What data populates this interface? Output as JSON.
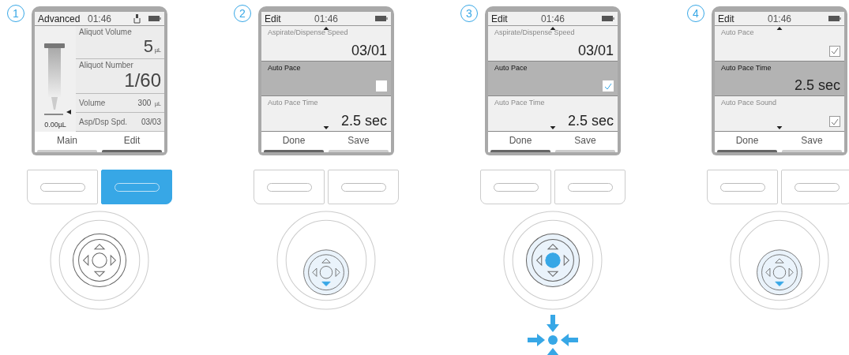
{
  "steps": [
    {
      "number": "1",
      "screen": {
        "title": "Advanced",
        "time": "01:46",
        "usb": true,
        "kind": "main",
        "tip_volume": "0.00µL",
        "fields": [
          {
            "kind": "large",
            "label": "Aliquot Volume",
            "value": "5",
            "unit": "µL"
          },
          {
            "kind": "large",
            "label": "Aliquot Number",
            "value": "1/60"
          },
          {
            "kind": "inline",
            "label": "Volume",
            "value": "300",
            "unit": "µL"
          },
          {
            "kind": "inline",
            "label": "Asp/Dsp Spd.",
            "value": "03/03"
          }
        ]
      },
      "softkeys": [
        {
          "label": "Main",
          "selected": false
        },
        {
          "label": "Edit",
          "selected": true
        }
      ],
      "buttons": [
        {
          "pressed": false
        },
        {
          "pressed": true
        }
      ],
      "joystick": {
        "down_pressed": false,
        "center_pressed": false
      }
    },
    {
      "number": "2",
      "screen": {
        "title": "Edit",
        "time": "01:46",
        "usb": false,
        "kind": "list",
        "rows": [
          {
            "kind": "value",
            "label": "Aspirate/Dispense Speed",
            "value": "03/01",
            "highlighted": false
          },
          {
            "kind": "check",
            "label": "Auto Pace",
            "checked": false,
            "highlighted": true
          },
          {
            "kind": "value",
            "label": "Auto Pace Time",
            "value": "2.5 sec",
            "highlighted": false
          }
        ]
      },
      "softkeys": [
        {
          "label": "Done",
          "selected": true
        },
        {
          "label": "Save",
          "selected": false
        }
      ],
      "buttons": [
        {
          "pressed": false
        },
        {
          "pressed": false
        }
      ],
      "joystick": {
        "down_pressed": true,
        "center_pressed": false
      }
    },
    {
      "number": "3",
      "screen": {
        "title": "Edit",
        "time": "01:46",
        "usb": false,
        "kind": "list",
        "rows": [
          {
            "kind": "value",
            "label": "Aspirate/Dispense Speed",
            "value": "03/01",
            "highlighted": false
          },
          {
            "kind": "check",
            "label": "Auto Pace",
            "checked": true,
            "highlighted": true
          },
          {
            "kind": "value",
            "label": "Auto Pace Time",
            "value": "2.5 sec",
            "highlighted": false
          }
        ]
      },
      "softkeys": [
        {
          "label": "Done",
          "selected": true
        },
        {
          "label": "Save",
          "selected": false
        }
      ],
      "buttons": [
        {
          "pressed": false
        },
        {
          "pressed": false
        }
      ],
      "joystick": {
        "down_pressed": false,
        "center_pressed": true
      }
    },
    {
      "number": "4",
      "screen": {
        "title": "Edit",
        "time": "01:46",
        "usb": false,
        "kind": "list",
        "rows": [
          {
            "kind": "check",
            "label": "Auto Pace",
            "checked": true,
            "highlighted": false
          },
          {
            "kind": "value",
            "label": "Auto Pace Time",
            "value": "2.5 sec",
            "highlighted": true
          },
          {
            "kind": "check",
            "label": "Auto Pace Sound",
            "checked": true,
            "highlighted": false
          }
        ]
      },
      "softkeys": [
        {
          "label": "Done",
          "selected": true
        },
        {
          "label": "Save",
          "selected": false
        }
      ],
      "buttons": [
        {
          "pressed": false
        },
        {
          "pressed": false
        }
      ],
      "joystick": {
        "down_pressed": true,
        "center_pressed": false
      }
    }
  ]
}
